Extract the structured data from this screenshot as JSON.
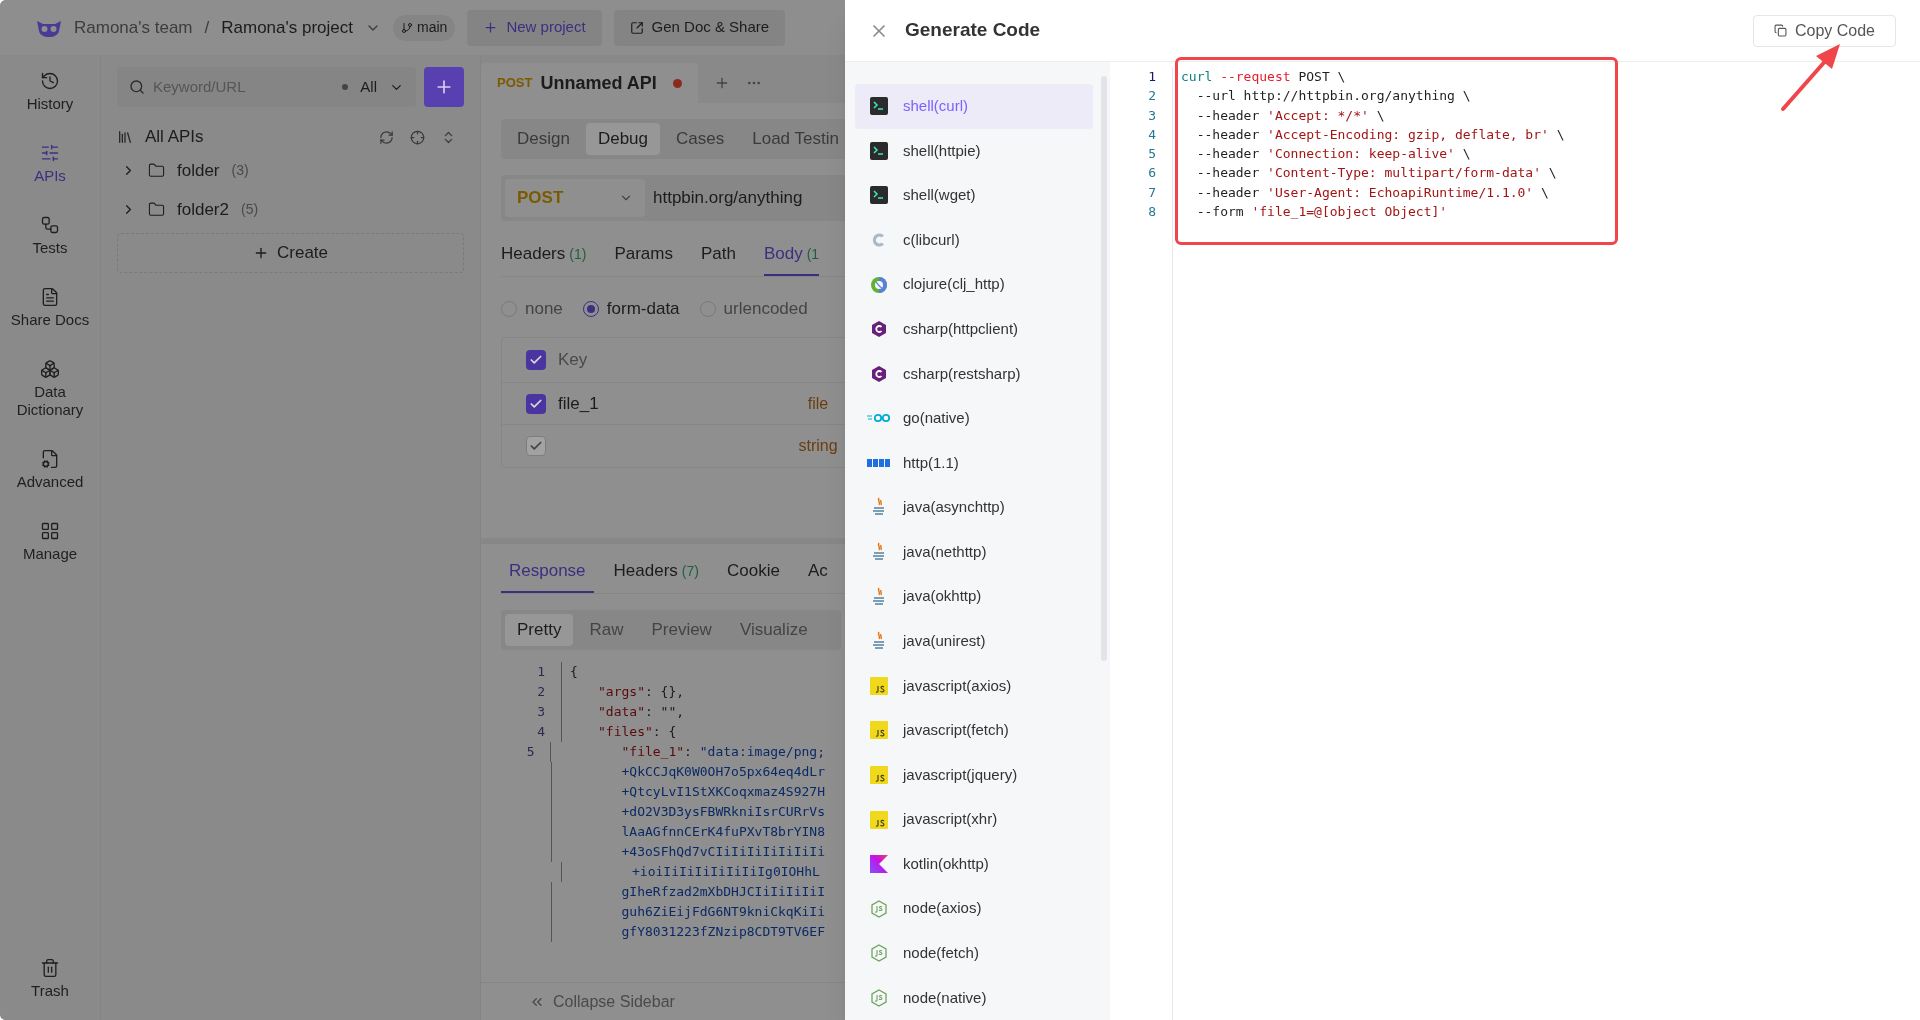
{
  "header": {
    "team": "Ramona's team",
    "separator": "/",
    "project": "Ramona's project",
    "branch": "main",
    "buttons": [
      {
        "label": "New project",
        "kind": "add"
      },
      {
        "label": "Gen Doc & Share",
        "kind": "share"
      }
    ]
  },
  "nav": [
    {
      "label": "History",
      "kind": "history",
      "selected": false
    },
    {
      "label": "APIs",
      "kind": "apis",
      "selected": true
    },
    {
      "label": "Tests",
      "kind": "tests",
      "selected": false
    },
    {
      "label": "Share Docs",
      "kind": "docs",
      "selected": false
    },
    {
      "label": "Data Dictionary",
      "kind": "dictionary",
      "selected": false
    },
    {
      "label": "Advanced",
      "kind": "advanced",
      "selected": false
    },
    {
      "label": "Manage",
      "kind": "manage",
      "selected": false
    }
  ],
  "nav_footer": {
    "label": "Trash",
    "kind": "trash",
    "selected": false
  },
  "tree": {
    "search": {
      "placeholder": "Keyword/URL"
    },
    "filter": "All",
    "title": "All APIs",
    "folders": [
      {
        "name": "folder",
        "count": "(3)",
        "expanded": false
      },
      {
        "name": "folder2",
        "count": "(5)",
        "expanded": false
      }
    ],
    "create": "Create"
  },
  "request": {
    "tab": {
      "method": "POST",
      "title": "Unnamed API",
      "unsaved": true
    },
    "modes": [
      {
        "label": "Design",
        "selected": false
      },
      {
        "label": "Debug",
        "selected": true
      },
      {
        "label": "Cases",
        "selected": false
      },
      {
        "label": "Load Testin",
        "selected": false
      }
    ],
    "method": "POST",
    "url": "httpbin.org/anything",
    "tabs": [
      {
        "label": "Headers",
        "count": "(1)",
        "selected": false
      },
      {
        "label": "Params",
        "selected": false
      },
      {
        "label": "Path",
        "selected": false
      },
      {
        "label": "Body",
        "count": "(1",
        "selected": true
      }
    ],
    "body_types": [
      {
        "label": "none",
        "selected": false
      },
      {
        "label": "form-data",
        "selected": true
      },
      {
        "label": "urlencoded",
        "selected": false
      }
    ],
    "table": {
      "header": {
        "checked": true,
        "label": "Key"
      },
      "rows": [
        {
          "checked": true,
          "disabled": false,
          "key": "file_1",
          "type": "file"
        },
        {
          "checked": true,
          "disabled": true,
          "type": "string"
        }
      ]
    }
  },
  "response": {
    "tabs": [
      {
        "label": "Response",
        "selected": true
      },
      {
        "label": "Headers",
        "count": "(7)",
        "selected": false
      },
      {
        "label": "Cookie",
        "selected": false
      },
      {
        "label": "Ac",
        "selected": false
      }
    ],
    "views": [
      {
        "label": "Pretty",
        "selected": true
      },
      {
        "label": "Raw",
        "selected": false
      },
      {
        "label": "Preview",
        "selected": false
      },
      {
        "label": "Visualize",
        "selected": false
      }
    ],
    "lines": [
      {
        "number": "1",
        "kind": "root",
        "tokens": [
          {
            "text": "{",
            "kind": "punct"
          }
        ]
      },
      {
        "number": "2",
        "kind": "member",
        "tokens": [
          {
            "text": "\"args\"",
            "kind": "key"
          },
          {
            "text": ": {},",
            "kind": "punct"
          }
        ]
      },
      {
        "number": "3",
        "kind": "member",
        "tokens": [
          {
            "text": "\"data\"",
            "kind": "key"
          },
          {
            "text": ": \"\",",
            "kind": "punct"
          }
        ]
      },
      {
        "number": "4",
        "kind": "member",
        "tokens": [
          {
            "text": "\"files\"",
            "kind": "key"
          },
          {
            "text": ": {",
            "kind": "punct"
          }
        ]
      },
      {
        "number": "5",
        "kind": "inner",
        "tokens": [
          {
            "text": "\"file_1\"",
            "kind": "key"
          },
          {
            "text": ": ",
            "kind": "punct"
          },
          {
            "text": "\"data:image/png;",
            "kind": "value"
          }
        ]
      },
      {
        "kind": "inner",
        "tokens": [
          {
            "text": "+QkCCJqK0W0OH7o5px64eq4dLr",
            "kind": "value"
          }
        ]
      },
      {
        "kind": "inner",
        "tokens": [
          {
            "text": "+QtcyLvI1StXKCoqxmaz4S927H",
            "kind": "value"
          }
        ]
      },
      {
        "kind": "inner",
        "tokens": [
          {
            "text": "+dO2V3D3ysFBWRkniIsrCURrVs",
            "kind": "value"
          }
        ]
      },
      {
        "kind": "inner",
        "tokens": [
          {
            "text": "lAaAGfnnCErK4fuPXvT8brYIN8",
            "kind": "value"
          }
        ]
      },
      {
        "kind": "inner",
        "tokens": [
          {
            "text": "+43oSFhQd7vCIiIiIiIiIiIiIi",
            "kind": "value"
          }
        ]
      },
      {
        "kind": "inner",
        "tokens": [
          {
            "text": "+ioiIiIiIiIiIiIiIg0IOHhL",
            "kind": "value"
          }
        ]
      },
      {
        "kind": "inner",
        "tokens": [
          {
            "text": "gIheRfzad2mXbDHJCIiIiIiIiI",
            "kind": "value"
          }
        ]
      },
      {
        "kind": "inner",
        "tokens": [
          {
            "text": "guh6ZiEijFdG6NT9kniCkqKiIi",
            "kind": "value"
          }
        ]
      },
      {
        "kind": "inner",
        "tokens": [
          {
            "text": "gfY8031223fZNzip8CDT9TV6EF",
            "kind": "value"
          }
        ]
      }
    ]
  },
  "collapse": "Collapse Sidebar",
  "drawer": {
    "title": "Generate Code",
    "copy_button": "Copy Code",
    "languages": [
      {
        "label": "shell(curl)",
        "kind": "terminal",
        "selected": true
      },
      {
        "label": "shell(httpie)",
        "kind": "terminal",
        "selected": false
      },
      {
        "label": "shell(wget)",
        "kind": "terminal",
        "selected": false
      },
      {
        "label": "c(libcurl)",
        "kind": "c",
        "selected": false
      },
      {
        "label": "clojure(clj_http)",
        "kind": "clojure",
        "selected": false
      },
      {
        "label": "csharp(httpclient)",
        "kind": "csharp",
        "selected": false
      },
      {
        "label": "csharp(restsharp)",
        "kind": "csharp",
        "selected": false
      },
      {
        "label": "go(native)",
        "kind": "go",
        "selected": false
      },
      {
        "label": "http(1.1)",
        "kind": "http",
        "selected": false
      },
      {
        "label": "java(asynchttp)",
        "kind": "java",
        "selected": false
      },
      {
        "label": "java(nethttp)",
        "kind": "java",
        "selected": false
      },
      {
        "label": "java(okhttp)",
        "kind": "java",
        "selected": false
      },
      {
        "label": "java(unirest)",
        "kind": "java",
        "selected": false
      },
      {
        "label": "javascript(axios)",
        "kind": "js",
        "selected": false
      },
      {
        "label": "javascript(fetch)",
        "kind": "js",
        "selected": false
      },
      {
        "label": "javascript(jquery)",
        "kind": "js",
        "selected": false
      },
      {
        "label": "javascript(xhr)",
        "kind": "js",
        "selected": false
      },
      {
        "label": "kotlin(okhttp)",
        "kind": "kotlin",
        "selected": false
      },
      {
        "label": "node(axios)",
        "kind": "node",
        "selected": false
      },
      {
        "label": "node(fetch)",
        "kind": "node",
        "selected": false
      },
      {
        "label": "node(native)",
        "kind": "node",
        "selected": false
      }
    ],
    "code": [
      {
        "number": "1",
        "current": true,
        "tokens": [
          {
            "text": "curl",
            "kind": "command"
          },
          {
            "text": " --request",
            "kind": "keyword"
          },
          {
            "text": " POST \\",
            "kind": "plain"
          }
        ]
      },
      {
        "number": "2",
        "current": false,
        "tokens": [
          {
            "text": "  --url http://httpbin.org/anything \\",
            "kind": "plain"
          }
        ]
      },
      {
        "number": "3",
        "current": false,
        "tokens": [
          {
            "text": "  --header ",
            "kind": "plain"
          },
          {
            "text": "'Accept: */*'",
            "kind": "string"
          },
          {
            "text": " \\",
            "kind": "plain"
          }
        ]
      },
      {
        "number": "4",
        "current": false,
        "tokens": [
          {
            "text": "  --header ",
            "kind": "plain"
          },
          {
            "text": "'Accept-Encoding: gzip, deflate, br'",
            "kind": "string"
          },
          {
            "text": " \\",
            "kind": "plain"
          }
        ]
      },
      {
        "number": "5",
        "current": false,
        "tokens": [
          {
            "text": "  --header ",
            "kind": "plain"
          },
          {
            "text": "'Connection: keep-alive'",
            "kind": "string"
          },
          {
            "text": " \\",
            "kind": "plain"
          }
        ]
      },
      {
        "number": "6",
        "current": false,
        "tokens": [
          {
            "text": "  --header ",
            "kind": "plain"
          },
          {
            "text": "'Content-Type: multipart/form-data'",
            "kind": "string"
          },
          {
            "text": " \\",
            "kind": "plain"
          }
        ]
      },
      {
        "number": "7",
        "current": false,
        "tokens": [
          {
            "text": "  --header ",
            "kind": "plain"
          },
          {
            "text": "'User-Agent: EchoapiRuntime/1.1.0'",
            "kind": "string"
          },
          {
            "text": " \\",
            "kind": "plain"
          }
        ]
      },
      {
        "number": "8",
        "current": false,
        "tokens": [
          {
            "text": "  --form ",
            "kind": "plain"
          },
          {
            "text": "'file_1=@[object Object]'",
            "kind": "string"
          }
        ]
      }
    ],
    "annotations": {
      "highlight_box": true,
      "arrow": true
    }
  }
}
